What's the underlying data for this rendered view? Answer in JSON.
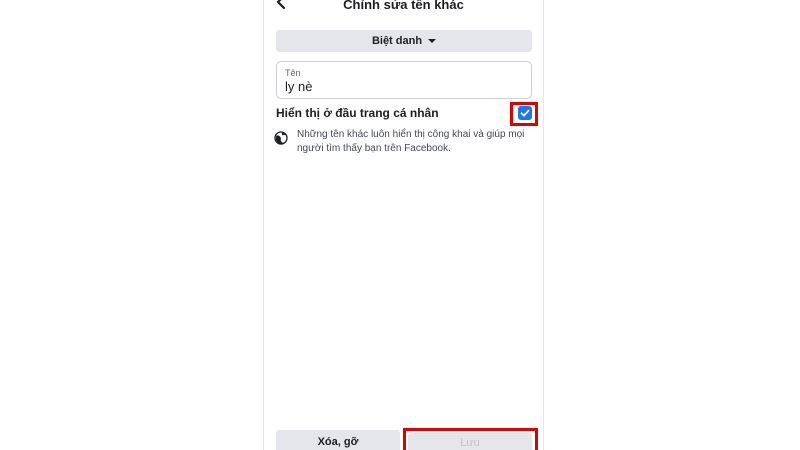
{
  "header": {
    "title": "Chỉnh sửa tên khác",
    "back_icon": "chevron-left-icon"
  },
  "form": {
    "type_select": {
      "selected": "Biệt danh",
      "icon": "caret-down-icon"
    },
    "name_field": {
      "label": "Tên",
      "value": "ly nè"
    },
    "show_on_profile": {
      "label": "Hiển thị ở đầu trang cá nhân",
      "checked": true
    },
    "info": {
      "icon": "globe-icon",
      "text": "Những tên khác luôn hiển thị công khai và giúp mọi người tìm thấy bạn trên Facebook."
    }
  },
  "footer": {
    "delete_label": "Xóa, gỡ",
    "save_label": "Lưu"
  },
  "colors": {
    "accent": "#1877f2",
    "highlight": "#e00000",
    "button_bg": "#e4e6eb"
  }
}
